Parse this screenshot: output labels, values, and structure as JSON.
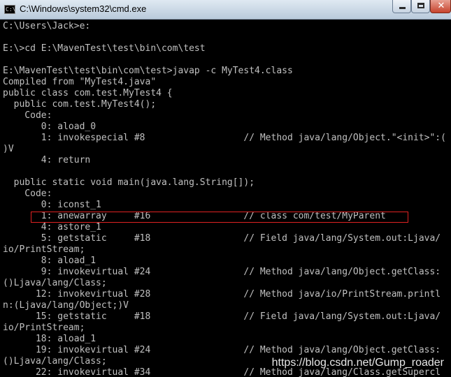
{
  "window": {
    "title": "C:\\Windows\\system32\\cmd.exe",
    "icon_label": "C:\\",
    "close_glyph": "✕"
  },
  "console": {
    "lines": [
      "C:\\Users\\Jack>e:",
      "",
      "E:\\>cd E:\\MavenTest\\test\\bin\\com\\test",
      "",
      "E:\\MavenTest\\test\\bin\\com\\test>javap -c MyTest4.class",
      "Compiled from \"MyTest4.java\"",
      "public class com.test.MyTest4 {",
      "  public com.test.MyTest4();",
      "    Code:",
      "       0: aload_0",
      "       1: invokespecial #8                  // Method java/lang/Object.\"<init>\":(",
      ")V",
      "       4: return",
      "",
      "  public static void main(java.lang.String[]);",
      "    Code:",
      "       0: iconst_1",
      "       1: anewarray     #16                 // class com/test/MyParent",
      "       4: astore_1",
      "       5: getstatic     #18                 // Field java/lang/System.out:Ljava/",
      "io/PrintStream;",
      "       8: aload_1",
      "       9: invokevirtual #24                 // Method java/lang/Object.getClass:",
      "()Ljava/lang/Class;",
      "      12: invokevirtual #28                 // Method java/io/PrintStream.printl",
      "n:(Ljava/lang/Object;)V",
      "      15: getstatic     #18                 // Field java/lang/System.out:Ljava/",
      "io/PrintStream;",
      "      18: aload_1",
      "      19: invokevirtual #24                 // Method java/lang/Object.getClass:",
      "()Ljava/lang/Class;",
      "      22: invokevirtual #34                 // Method java/lang/Class.getSupercl"
    ]
  },
  "watermark": "https://blog.csdn.net/Gump_roader",
  "colors": {
    "background": "#000000",
    "text": "#c0c0c0",
    "highlight": "#e02222"
  }
}
